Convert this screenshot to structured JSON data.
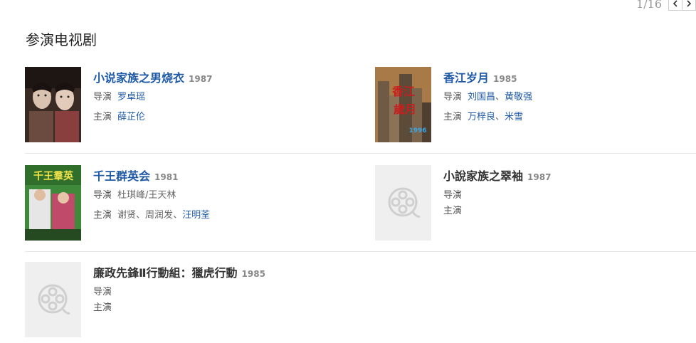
{
  "pager": {
    "text": "1/16"
  },
  "section": {
    "title": "参演电视剧"
  },
  "labels": {
    "director": "导演",
    "cast": "主演"
  },
  "items": [
    {
      "title": "小说家族之男烧衣",
      "year": "1987",
      "directors": [
        "罗卓瑶"
      ],
      "cast": [
        "薛芷伦"
      ]
    },
    {
      "title": "香江岁月",
      "year": "1985",
      "directors": [
        "刘国昌",
        "黄敬强"
      ],
      "cast": [
        "万梓良",
        "米雪"
      ],
      "poster_text": "1996"
    },
    {
      "title": "千王群英会",
      "year": "1981",
      "directors_text": "杜琪峰/王天林",
      "cast_plain": [
        "谢贤",
        "周润发"
      ],
      "cast_link": "汪明荃"
    },
    {
      "title": "小說家族之翠袖",
      "year": "1987"
    },
    {
      "title": "廉政先鋒Ⅱ行動組：獵虎行動",
      "year": "1985"
    }
  ],
  "colors": {
    "link": "#1f5aa6",
    "placeholder_bg": "#efefef"
  }
}
